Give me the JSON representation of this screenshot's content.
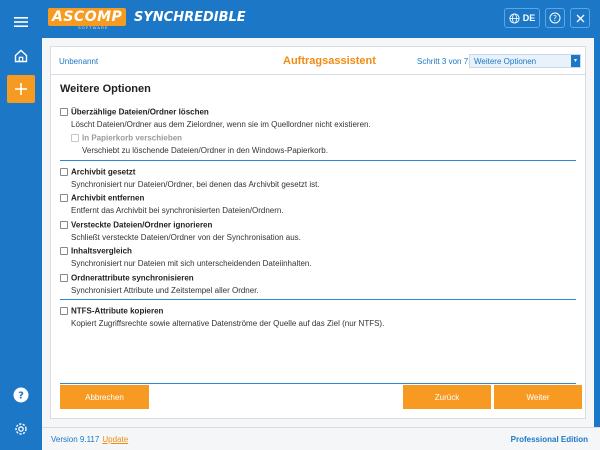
{
  "header": {
    "logo_text": "ASCOMP",
    "logo_sub": "SOFTWARE",
    "app_name": "SYNCHREDIBLE",
    "lang": "DE"
  },
  "sidebar": {
    "items": [
      {
        "icon": "menu-icon"
      },
      {
        "icon": "home-icon"
      },
      {
        "icon": "add-icon"
      },
      {
        "icon": "help-icon"
      },
      {
        "icon": "gear-icon"
      }
    ]
  },
  "wizard": {
    "crumb": "Unbenannt",
    "title": "Auftragsassistent",
    "step": "Schritt 3 von 7:",
    "step_select": "Weitere Optionen",
    "section_title": "Weitere Optionen"
  },
  "options": [
    {
      "label": "Überzählige Dateien/Ordner löschen",
      "desc": "Löscht Dateien/Ordner aus dem Zielordner, wenn sie im Quellordner nicht existieren.",
      "checked": false
    },
    {
      "label": "In Papierkorb verschieben",
      "desc": "Verschiebt zu löschende Dateien/Ordner in den Windows-Papierkorb.",
      "checked": false,
      "disabled": true
    },
    {
      "label": "Archivbit gesetzt",
      "desc": "Synchronisiert nur Dateien/Ordner, bei denen das Archivbit gesetzt ist.",
      "checked": false
    },
    {
      "label": "Archivbit entfernen",
      "desc": "Entfernt das Archivbit bei synchronisierten Dateien/Ordnern.",
      "checked": false
    },
    {
      "label": "Versteckte Dateien/Ordner ignorieren",
      "desc": "Schließt versteckte Dateien/Ordner von der Synchronisation aus.",
      "checked": false
    },
    {
      "label": "Inhaltsvergleich",
      "desc": "Synchronisiert nur Dateien mit sich unterscheidenden Dateiinhalten.",
      "checked": false
    },
    {
      "label": "Ordnerattribute synchronisieren",
      "desc": "Synchronisiert Attribute und Zeitstempel aller Ordner.",
      "checked": false
    },
    {
      "label": "NTFS-Attribute kopieren",
      "desc": "Kopiert Zugriffsrechte sowie alternative Datenströme der Quelle auf das Ziel (nur NTFS).",
      "checked": false
    }
  ],
  "buttons": {
    "cancel": "Abbrechen",
    "back": "Zurück",
    "next": "Weiter"
  },
  "footer": {
    "version": "Version 9.117",
    "update": "Update",
    "edition": "Professional Edition"
  },
  "colors": {
    "accent": "#1c78c6",
    "orange": "#f79a22"
  }
}
